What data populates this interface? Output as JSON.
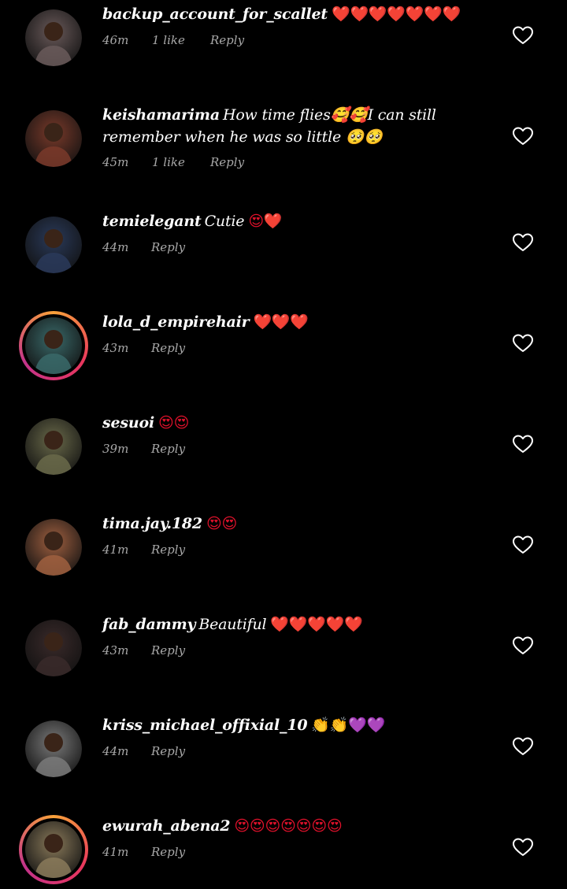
{
  "comments": [
    {
      "username": "backup_account_for_scallet",
      "text": "",
      "emoji": "❤️❤️❤️❤️❤️❤️❤️",
      "time": "46m",
      "likes": "1 like",
      "reply": "Reply",
      "story": false,
      "avatar_color": "#6a5a5a"
    },
    {
      "username": "keishamarima",
      "text": "How time flies🥰🥰I can still remember when he was so little 🥺🥺",
      "emoji": "",
      "time": "45m",
      "likes": "1 like",
      "reply": "Reply",
      "story": false,
      "avatar_color": "#7a3a2a"
    },
    {
      "username": "temielegant",
      "text": "Cutie",
      "emoji": "😍❤️",
      "time": "44m",
      "likes": "",
      "reply": "Reply",
      "story": false,
      "avatar_color": "#2a3a5a"
    },
    {
      "username": "lola_d_empirehair",
      "text": "",
      "emoji": "❤️❤️❤️",
      "time": "43m",
      "likes": "",
      "reply": "Reply",
      "story": true,
      "avatar_color": "#3a6a6a"
    },
    {
      "username": "sesuoi",
      "text": "",
      "emoji": "😍😍",
      "time": "39m",
      "likes": "",
      "reply": "Reply",
      "story": false,
      "avatar_color": "#6a6a4a"
    },
    {
      "username": "tima.jay.182",
      "text": "",
      "emoji": "😍😍",
      "time": "41m",
      "likes": "",
      "reply": "Reply",
      "story": false,
      "avatar_color": "#a06040"
    },
    {
      "username": "fab_dammy",
      "text": "Beautiful",
      "emoji": "❤️❤️❤️❤️❤️",
      "time": "43m",
      "likes": "",
      "reply": "Reply",
      "story": false,
      "avatar_color": "#3a2a2a"
    },
    {
      "username": "kriss_michael_offixial_10",
      "text": "",
      "emoji": "👏👏💜💜",
      "time": "44m",
      "likes": "",
      "reply": "Reply",
      "story": false,
      "avatar_color": "#7a7a7a"
    },
    {
      "username": "ewurah_abena2",
      "text": "",
      "emoji": "😍😍😍😍😍😍😍",
      "time": "41m",
      "likes": "",
      "reply": "Reply",
      "story": true,
      "avatar_color": "#8a7a5a"
    }
  ],
  "colors": {
    "background": "#000000",
    "text": "#ffffff",
    "meta": "#a8a8a8",
    "heart": "#e0112b"
  },
  "icons": {
    "like": "heart-outline-icon"
  }
}
